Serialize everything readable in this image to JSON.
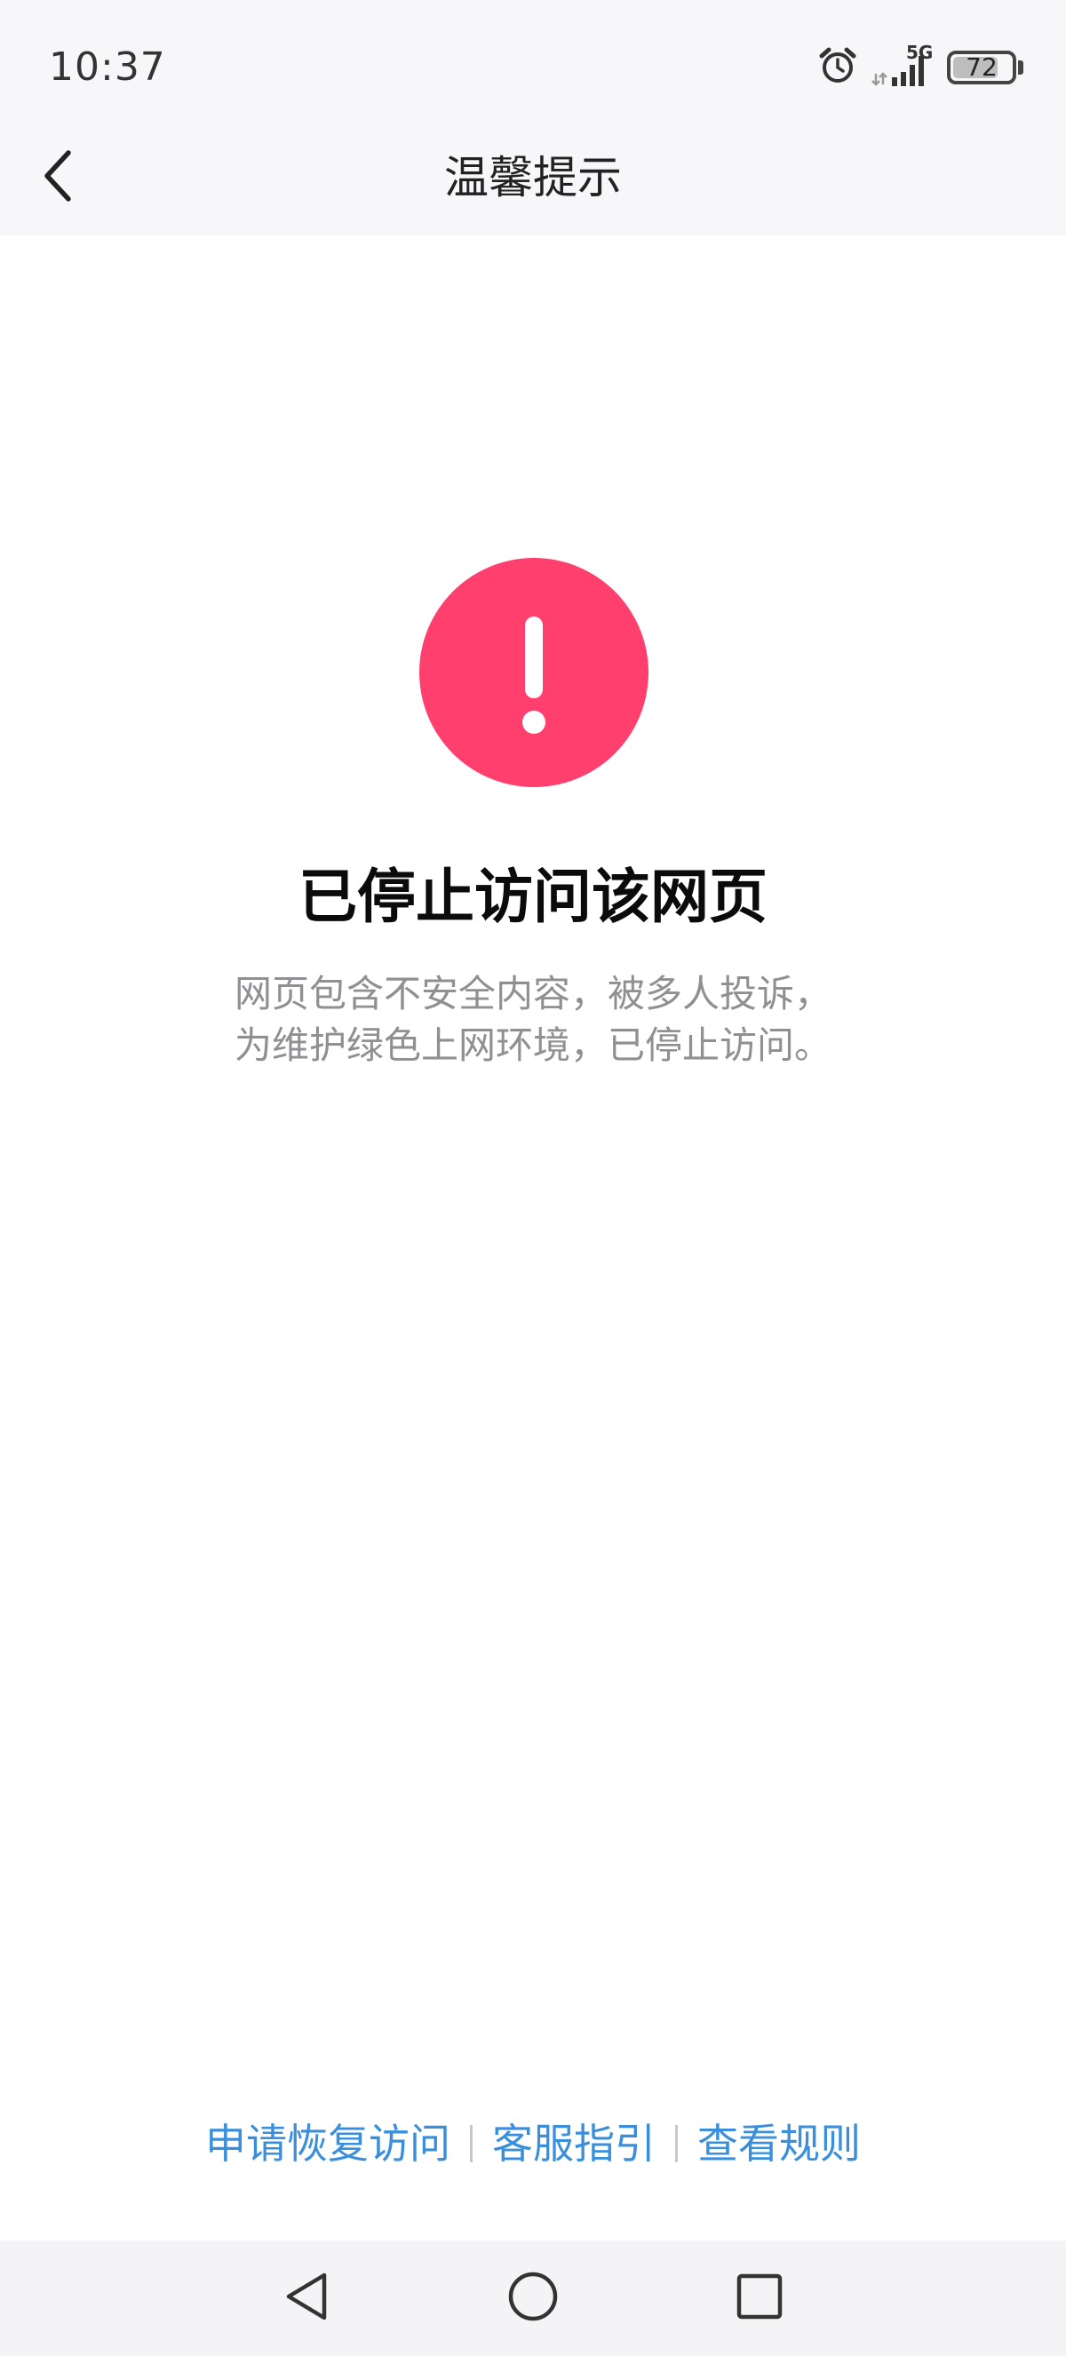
{
  "status_bar": {
    "time": "10:37",
    "network": "5G",
    "battery": "72",
    "battery_level": 0.72,
    "icons": [
      "alarm-icon",
      "signal-icon",
      "battery-icon"
    ]
  },
  "header": {
    "title": "温馨提示",
    "back_icon": "chevron-left-icon"
  },
  "main": {
    "alert_icon": "exclamation-icon",
    "alert_color": "#ff3f6e",
    "title": "已停止访问该网页",
    "description_line1": "网页包含不安全内容，被多人投诉，",
    "description_line2": "为维护绿色上网环境，已停止访问。"
  },
  "footer": {
    "links": [
      {
        "label": "申请恢复访问"
      },
      {
        "label": "客服指引"
      },
      {
        "label": "查看规则"
      }
    ],
    "link_color": "#3a8fdc"
  },
  "nav": {
    "icons": [
      "back-triangle-icon",
      "home-circle-icon",
      "recents-square-icon"
    ]
  }
}
